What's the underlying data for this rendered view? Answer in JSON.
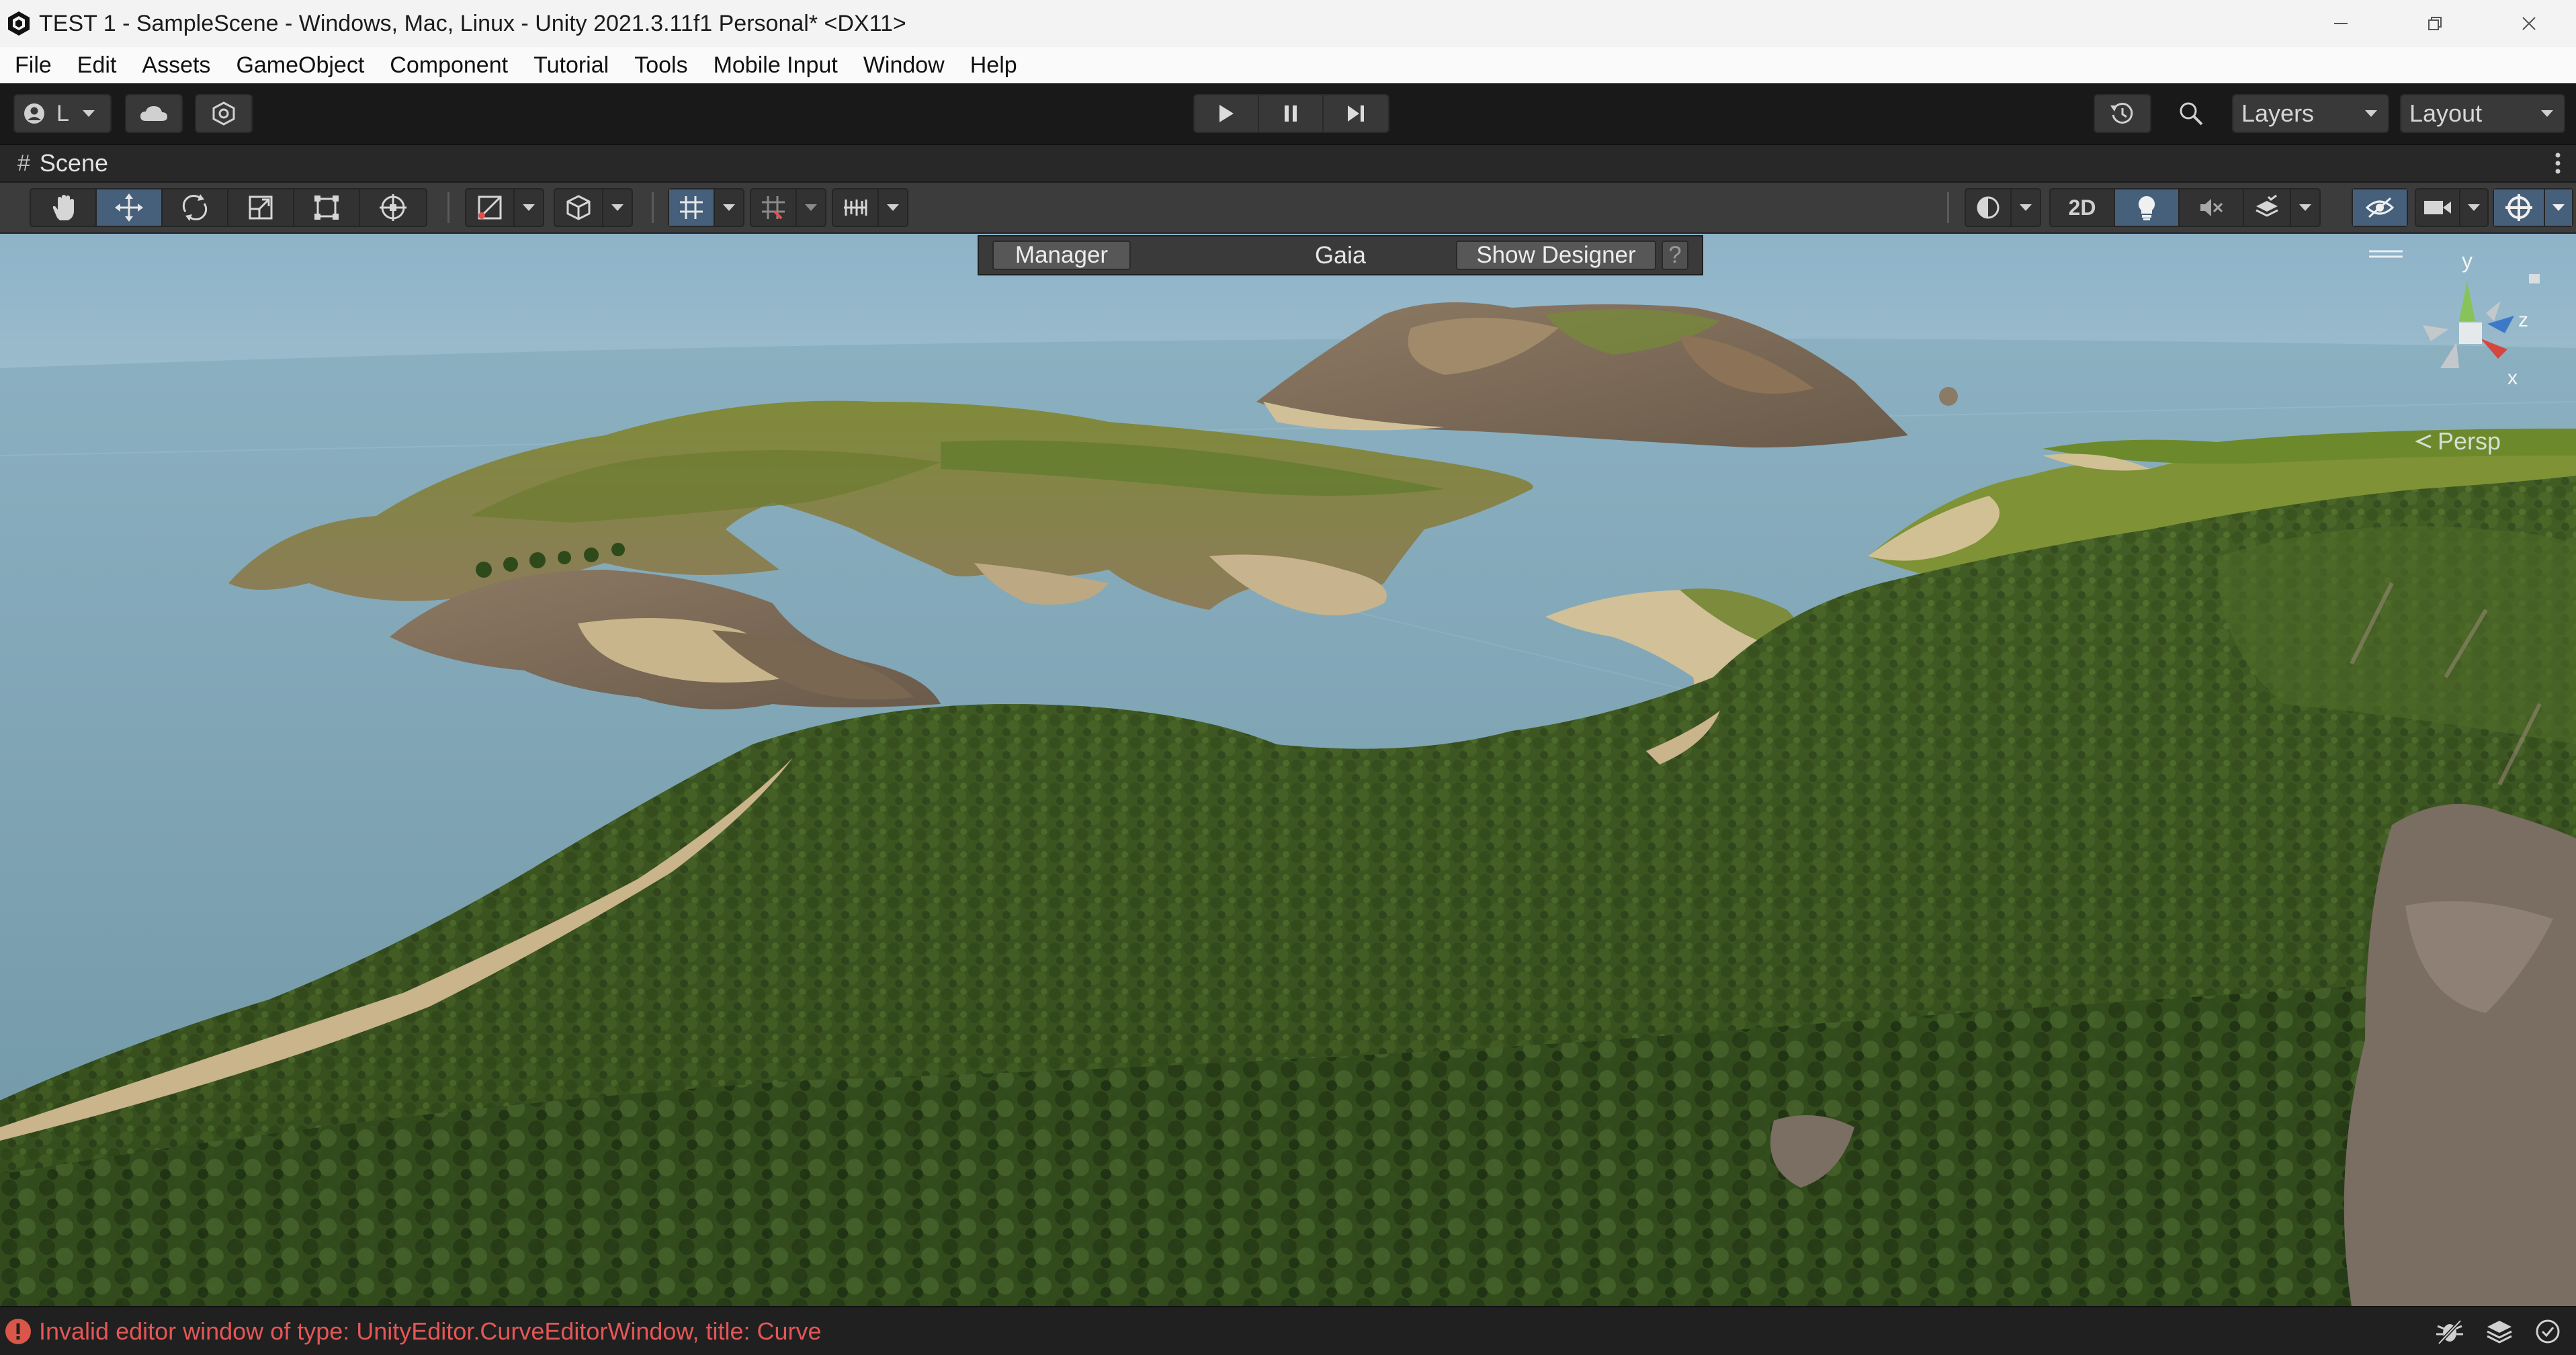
{
  "window": {
    "title": "TEST 1 - SampleScene - Windows, Mac, Linux - Unity 2021.3.11f1 Personal* <DX11>"
  },
  "menu": [
    "File",
    "Edit",
    "Assets",
    "GameObject",
    "Component",
    "Tutorial",
    "Tools",
    "Mobile Input",
    "Window",
    "Help"
  ],
  "toolbar": {
    "account_label": "L",
    "layers_label": "Layers",
    "layout_label": "Layout"
  },
  "scene_tab": {
    "label": "Scene"
  },
  "scene_toolbar": {
    "mode_2d_label": "2D"
  },
  "gaia_overlay": {
    "manager_label": "Manager",
    "title": "Gaia",
    "show_designer_label": "Show Designer",
    "help_label": "?"
  },
  "gizmo": {
    "axis_y": "y",
    "axis_z": "z",
    "axis_x": "x",
    "projection_label": "Persp"
  },
  "status_bar": {
    "message": "Invalid editor window of type: UnityEditor.CurveEditorWindow, title: Curve",
    "message_color": "#e45757"
  },
  "colors": {
    "accent_active": "#46607c",
    "toolbar_bg": "#191919",
    "water": "#7ea4b5",
    "forest": "#3d5420"
  }
}
